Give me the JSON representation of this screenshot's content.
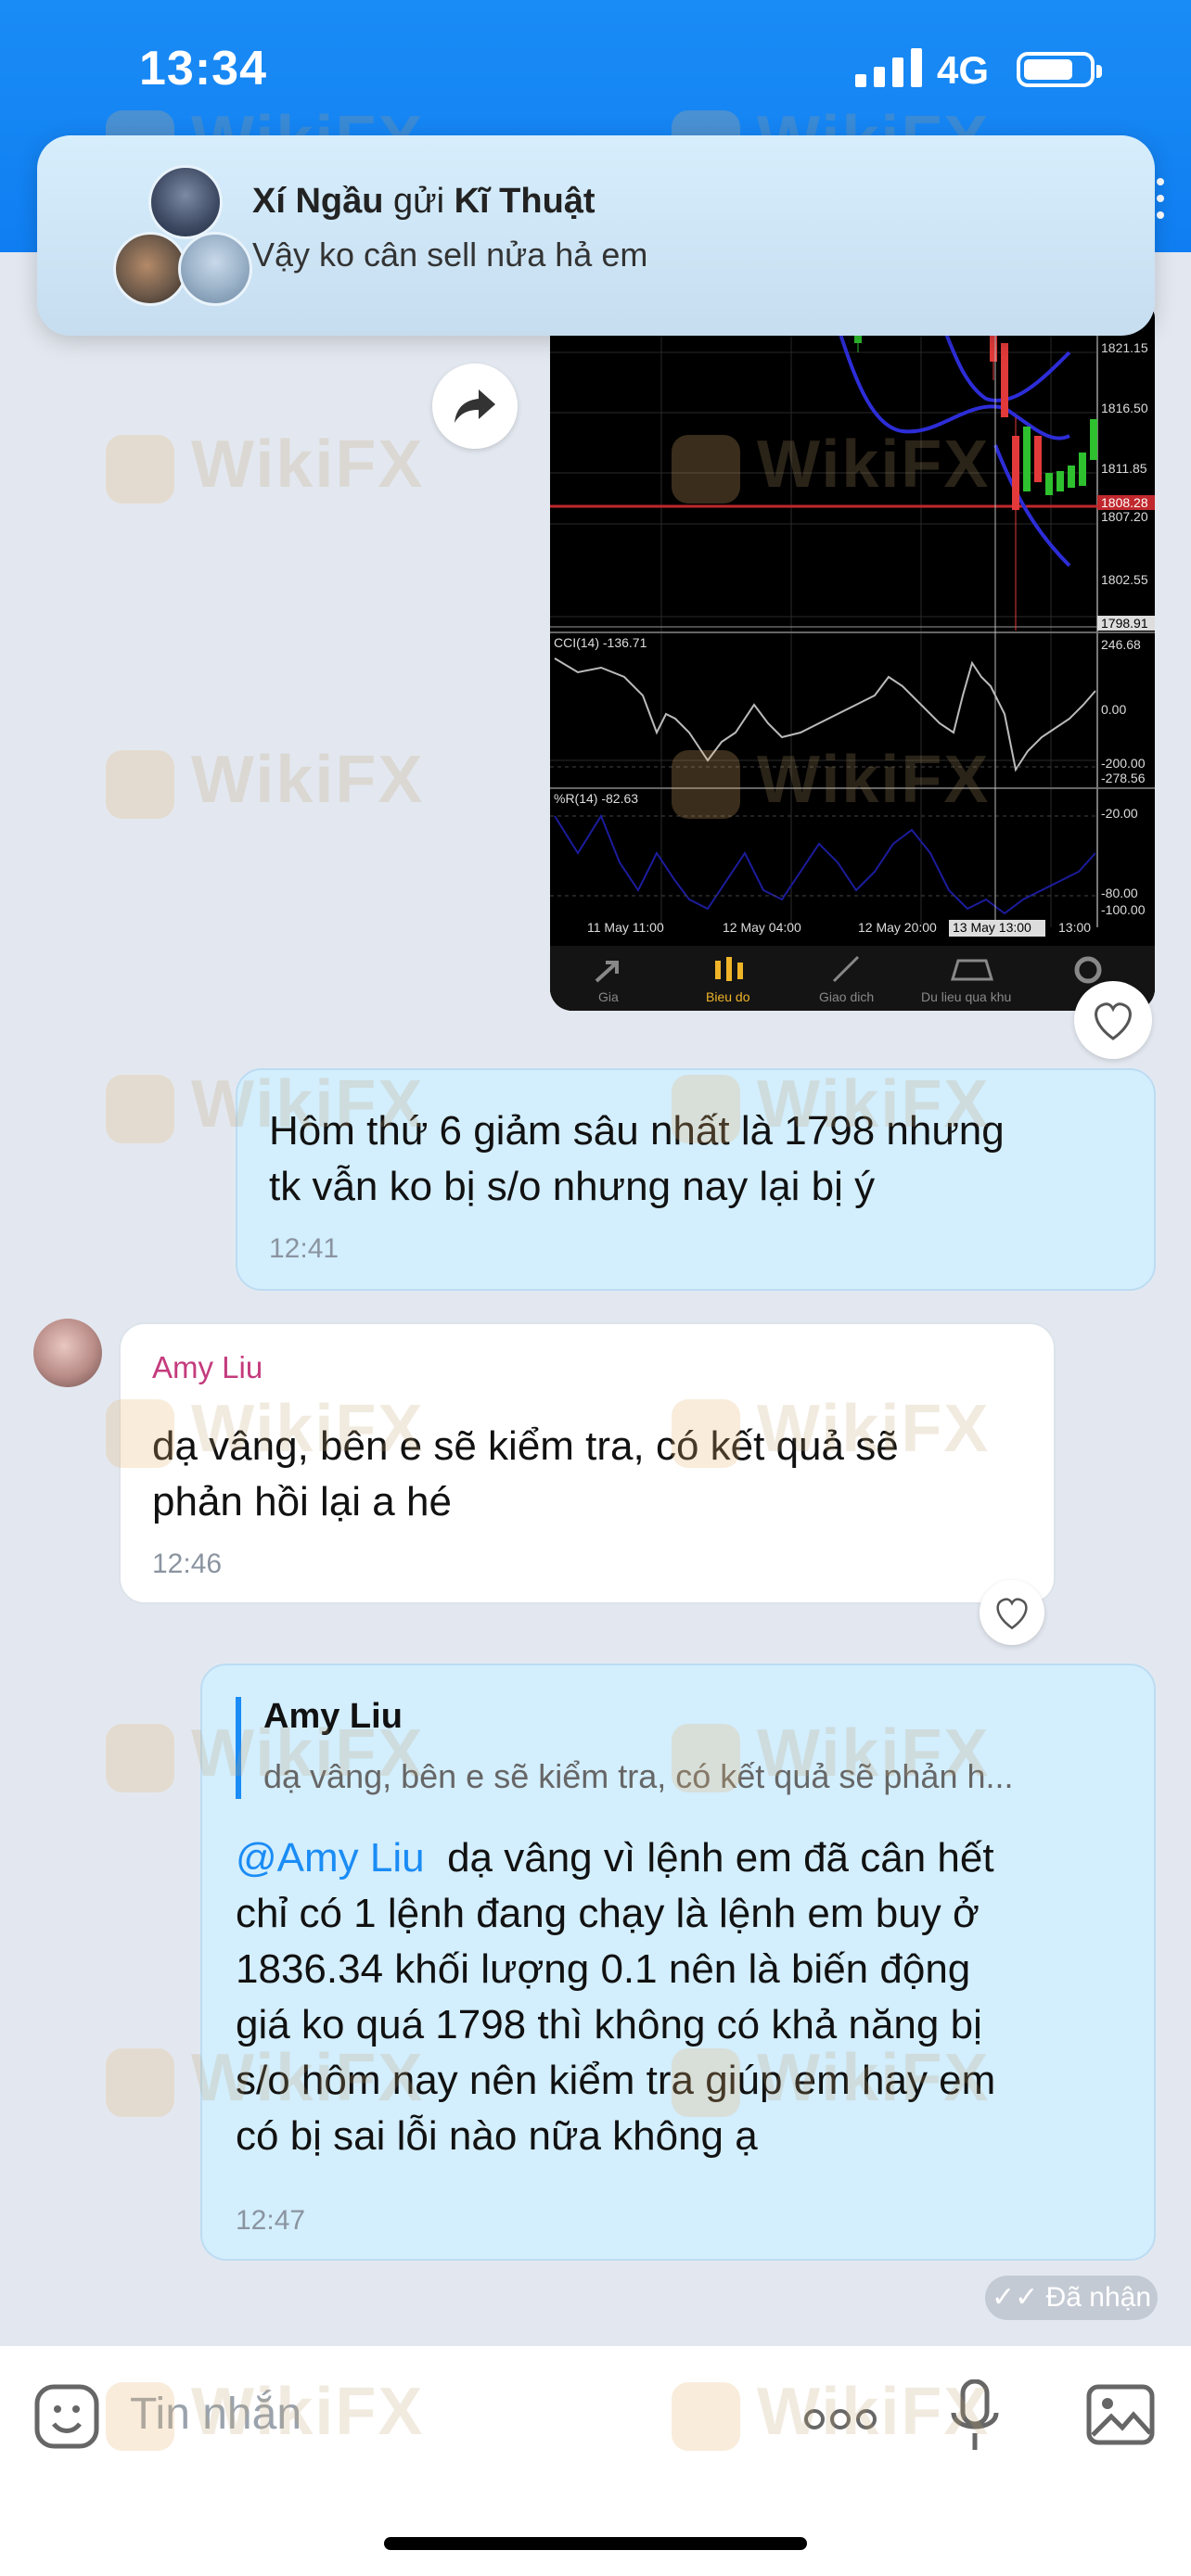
{
  "status_bar": {
    "time": "13:34",
    "network": "4G",
    "accent": "#1a8cf5"
  },
  "notification": {
    "sender": "Xí Ngầu",
    "verb": " gửi ",
    "group": "Kĩ Thuật",
    "text": "Vậy ko cân sell nửa hả em"
  },
  "chart": {
    "price_labels": [
      "1821.15",
      "1816.50",
      "1811.85",
      "1808.28",
      "1807.20",
      "1802.55",
      "1798.91"
    ],
    "cci_label": "CCI(14) -136.71",
    "cci_levels": [
      "246.68",
      "0.00",
      "-200.00",
      "-278.56"
    ],
    "wr_label": "%R(14) -82.63",
    "wr_levels": [
      "-20.00",
      "-80.00",
      "-100.00"
    ],
    "time_labels": [
      "11 May 11:00",
      "12 May 04:00",
      "12 May 20:00",
      "13 May 13:00",
      "13:00"
    ],
    "tabs": [
      "Gia",
      "Bieu do",
      "Giao dich",
      "Du lieu qua khu",
      "C"
    ]
  },
  "messages": [
    {
      "side": "me",
      "text_line1": "Hôm thứ 6 giảm sâu nhất là 1798 nhưng",
      "text_line2": "tk vẫn ko bị s/o nhưng nay lại bị ý",
      "time": "12:41"
    },
    {
      "side": "them",
      "sender": "Amy Liu",
      "text_line1": "dạ vâng, bên e sẽ kiểm tra, có kết quả sẽ",
      "text_line2": "phản hồi lại a hé",
      "time": "12:46"
    },
    {
      "side": "me",
      "reply_to_name": "Amy Liu",
      "reply_to_text": "dạ vâng, bên e sẽ kiểm tra, có kết quả sẽ phản h...",
      "mention": "@Amy Liu",
      "line1_rest": "dạ vâng vì lệnh em đã cân hết",
      "line2": "chỉ có 1 lệnh đang chạy là lệnh em buy ở",
      "line3": "1836.34 khối lượng 0.1 nên là biến động",
      "line4": "giá ko quá 1798 thì không có khả năng bị",
      "line5": "s/o hôm nay nên kiểm tra giúp em hay em",
      "line6": "có bị sai lỗi nào nữa không ạ",
      "time": "12:47"
    }
  ],
  "received_status": "Đã nhận",
  "compose": {
    "placeholder": "Tin nhắn"
  },
  "watermark": "WikiFX"
}
